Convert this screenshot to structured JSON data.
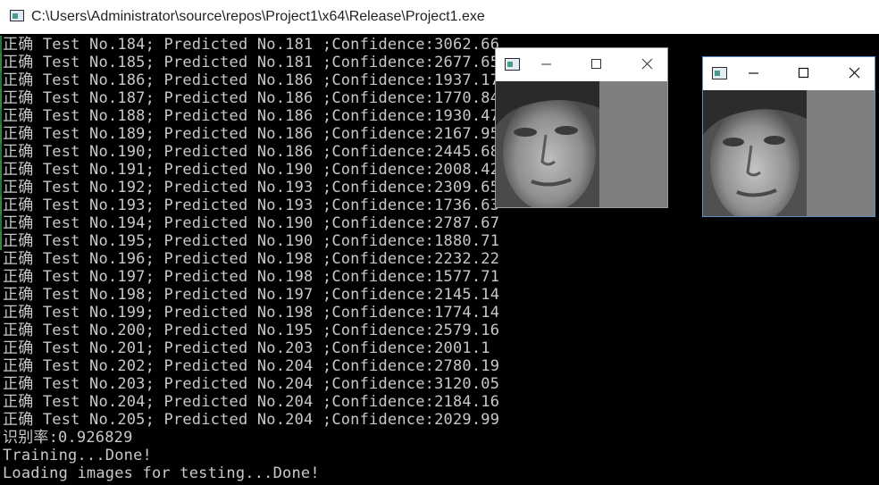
{
  "window": {
    "title": "C:\\Users\\Administrator\\source\\repos\\Project1\\x64\\Release\\Project1.exe"
  },
  "console": {
    "lines": [
      "正确 Test No.184; Predicted No.181 ;Confidence:3062.66",
      "正确 Test No.185; Predicted No.181 ;Confidence:2677.65",
      "正确 Test No.186; Predicted No.186 ;Confidence:1937.17",
      "正确 Test No.187; Predicted No.186 ;Confidence:1770.84",
      "正确 Test No.188; Predicted No.186 ;Confidence:1930.47",
      "正确 Test No.189; Predicted No.186 ;Confidence:2167.95",
      "正确 Test No.190; Predicted No.186 ;Confidence:2445.68",
      "正确 Test No.191; Predicted No.190 ;Confidence:2008.42",
      "正确 Test No.192; Predicted No.193 ;Confidence:2309.65",
      "正确 Test No.193; Predicted No.193 ;Confidence:1736.63",
      "正确 Test No.194; Predicted No.190 ;Confidence:2787.67",
      "正确 Test No.195; Predicted No.190 ;Confidence:1880.71",
      "正确 Test No.196; Predicted No.198 ;Confidence:2232.22",
      "正确 Test No.197; Predicted No.198 ;Confidence:1577.71",
      "正确 Test No.198; Predicted No.197 ;Confidence:2145.14",
      "正确 Test No.199; Predicted No.198 ;Confidence:1774.14",
      "正确 Test No.200; Predicted No.195 ;Confidence:2579.16",
      "正确 Test No.201; Predicted No.203 ;Confidence:2001.1",
      "正确 Test No.202; Predicted No.204 ;Confidence:2780.19",
      "正确 Test No.203; Predicted No.204 ;Confidence:3120.05",
      "正确 Test No.204; Predicted No.204 ;Confidence:2184.16",
      "正确 Test No.205; Predicted No.204 ;Confidence:2029.99",
      "识别率:0.926829",
      "Training...Done!",
      "Loading images for testing...Done!"
    ]
  },
  "image_windows": [
    {
      "title": "",
      "controls": [
        "minimize-icon",
        "maximize-icon",
        "close-icon"
      ]
    },
    {
      "title": "",
      "controls": [
        "minimize-icon",
        "maximize-icon",
        "close-icon"
      ]
    }
  ],
  "colors": {
    "console_bg": "#000000",
    "console_text": "#c8c8c8",
    "titlebar_bg": "#ffffff",
    "image_gray": "#7f7f7f"
  }
}
